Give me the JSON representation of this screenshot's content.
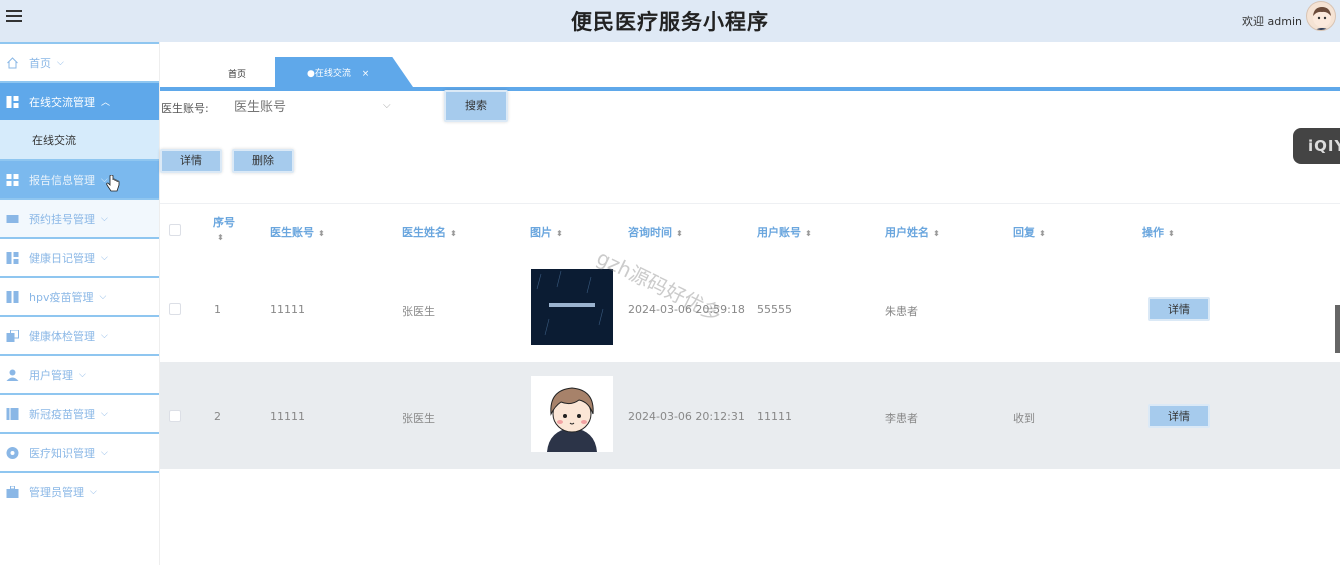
{
  "header": {
    "title": "便民医疗服务小程序",
    "welcome": "欢迎 admin"
  },
  "sidebar": {
    "items": [
      {
        "label": "首页",
        "icon": "home-icon",
        "state": "normal"
      },
      {
        "label": "在线交流管理",
        "icon": "grid-icon",
        "state": "active"
      },
      {
        "label": "在线交流",
        "icon": "",
        "state": "sub"
      },
      {
        "label": "报告信息管理",
        "icon": "grid-icon",
        "state": "hover"
      },
      {
        "label": "预约挂号管理",
        "icon": "card-icon",
        "state": "light"
      },
      {
        "label": "健康日记管理",
        "icon": "grid-icon",
        "state": "normal"
      },
      {
        "label": "hpv疫苗管理",
        "icon": "grid-icon",
        "state": "normal"
      },
      {
        "label": "健康体检管理",
        "icon": "copy-icon",
        "state": "normal"
      },
      {
        "label": "用户管理",
        "icon": "user-icon",
        "state": "normal"
      },
      {
        "label": "新冠疫苗管理",
        "icon": "book-icon",
        "state": "normal"
      },
      {
        "label": "医疗知识管理",
        "icon": "disc-icon",
        "state": "normal"
      },
      {
        "label": "管理员管理",
        "icon": "bag-icon",
        "state": "normal"
      }
    ]
  },
  "tabs": {
    "home": "首页",
    "active": "●在线交流",
    "close": "×"
  },
  "search": {
    "label": "医生账号:",
    "placeholder": "医生账号",
    "button": "搜索"
  },
  "toolbar": {
    "detail": "详情",
    "delete": "删除"
  },
  "overlay": {
    "iqiyi": "iQIY",
    "watermark": "gzh源码好优多"
  },
  "table": {
    "headers": [
      "序号",
      "医生账号",
      "医生姓名",
      "图片",
      "咨询时间",
      "用户账号",
      "用户姓名",
      "回复",
      "操作"
    ],
    "rows": [
      {
        "index": "1",
        "doctor_account": "11111",
        "doctor_name": "张医生",
        "image": "poster",
        "time": "2024-03-06 20:59:18",
        "user_account": "55555",
        "user_name": "朱患者",
        "reply": "",
        "action": "详情"
      },
      {
        "index": "2",
        "doctor_account": "11111",
        "doctor_name": "张医生",
        "image": "cartoon-avatar",
        "time": "2024-03-06 20:12:31",
        "user_account": "11111",
        "user_name": "李患者",
        "reply": "收到",
        "action": "详情"
      }
    ]
  }
}
